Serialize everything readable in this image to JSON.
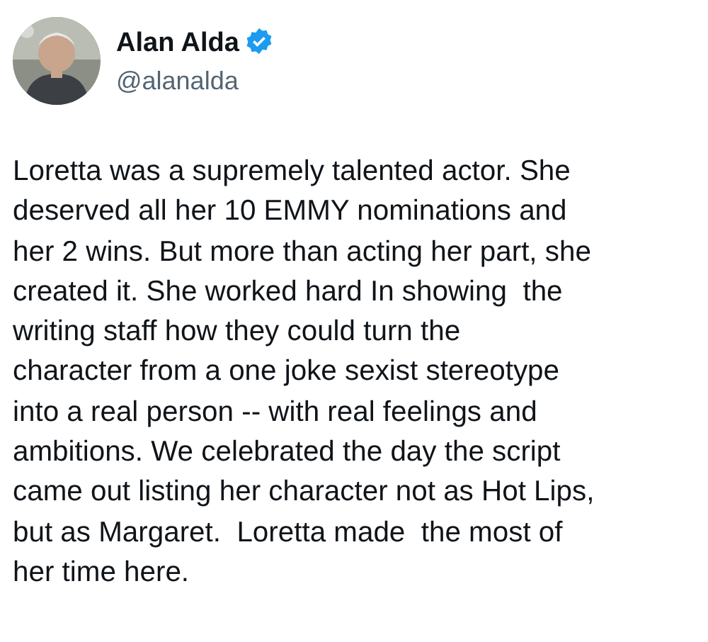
{
  "author": {
    "name": "Alan Alda",
    "verified": true,
    "handle": "@alanalda"
  },
  "post": {
    "text": "Loretta was a supremely talented actor. She\ndeserved all her 10 EMMY nominations and\nher 2 wins. But more than acting her part, she\ncreated it. She worked hard In showing  the\nwriting staff how they could turn the\ncharacter from a one joke sexist stereotype\ninto a real person -- with real feelings and\nambitions. We celebrated the day the script\ncame out listing her character not as Hot Lips,\nbut as Margaret.  Loretta made  the most of\nher time here."
  }
}
